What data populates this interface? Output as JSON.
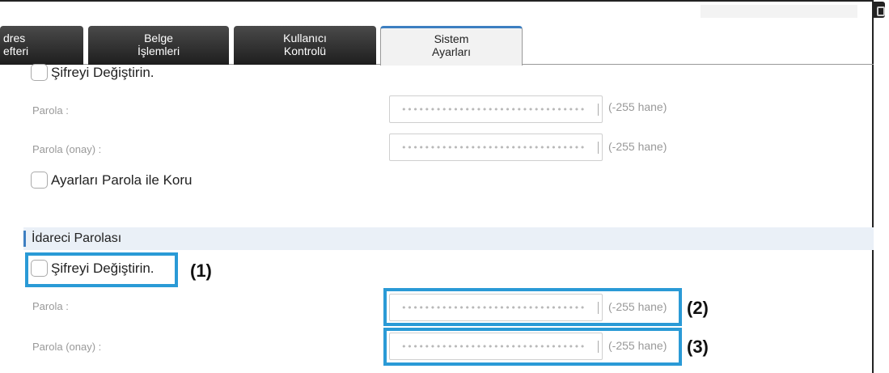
{
  "tabs": [
    {
      "line1": "dres",
      "line2": "efteri"
    },
    {
      "line1": "Belge",
      "line2": "İşlemleri"
    },
    {
      "line1": "Kullanıcı",
      "line2": "Kontrolü"
    },
    {
      "line1": "Sistem",
      "line2": "Ayarları"
    }
  ],
  "top_section": {
    "change_pw_label": "Şifreyi Değiştirin.",
    "password_label": "Parola :",
    "password_confirm_label": "Parola (onay) :",
    "password_value": "••••••••••••••••••••••••••••••••",
    "hint": "(-255 hane)",
    "protect_label": "Ayarları Parola ile Koru"
  },
  "admin_section": {
    "title": "İdareci Parolası",
    "change_pw_label": "Şifreyi Değiştirin.",
    "password_label": "Parola :",
    "password_confirm_label": "Parola (onay) :",
    "password_value": "••••••••••••••••••••••••••••••••",
    "hint": "(-255 hane)"
  },
  "callouts": [
    "(1)",
    "(2)",
    "(3)"
  ],
  "colors": {
    "highlight": "#2a9ad6",
    "active_tab_accent": "#3d7fc1"
  }
}
